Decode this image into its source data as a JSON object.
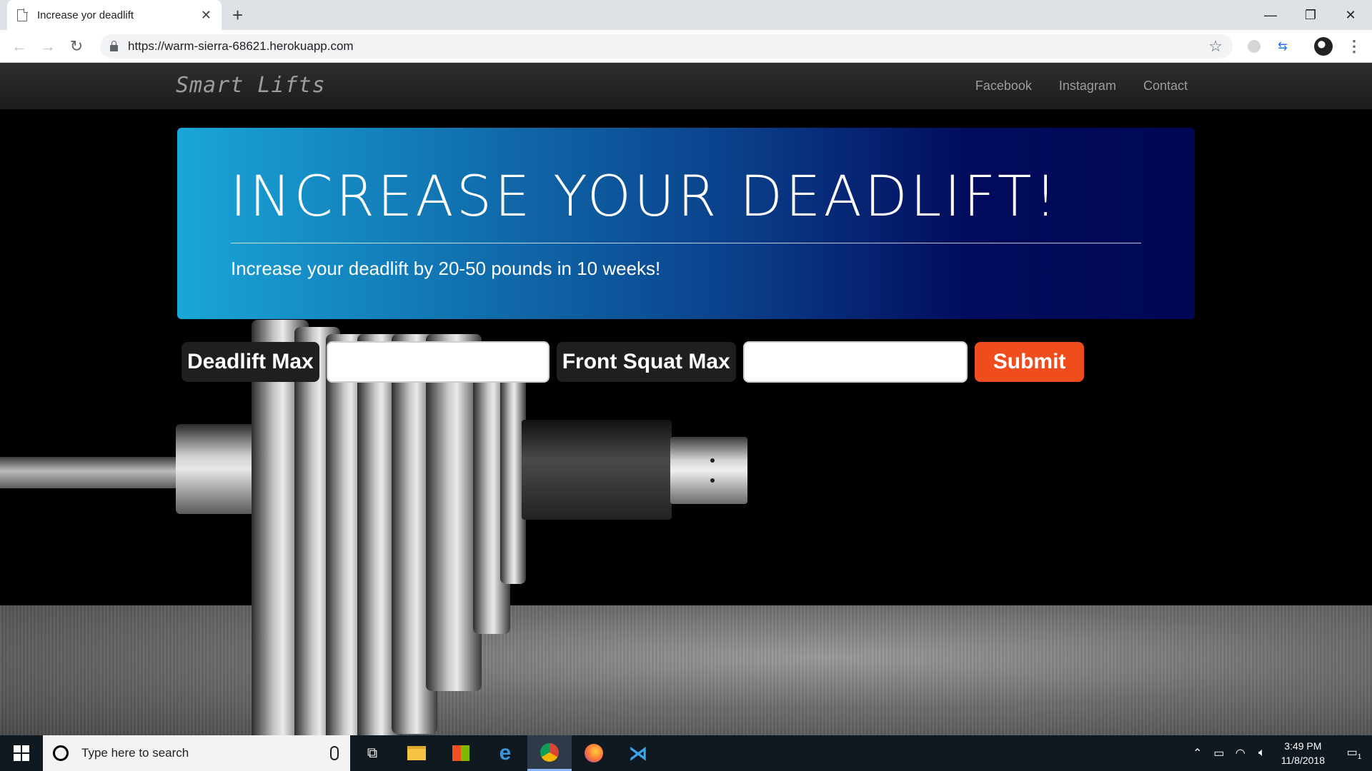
{
  "browser": {
    "tab_title": "Increase yor deadlift",
    "url": "https://warm-sierra-68621.herokuapp.com"
  },
  "navbar": {
    "brand": "Smart Lifts",
    "links": [
      {
        "label": "Facebook"
      },
      {
        "label": "Instagram"
      },
      {
        "label": "Contact"
      }
    ]
  },
  "jumbotron": {
    "headline": "INCREASE YOUR DEADLIFT!",
    "subtitle": "Increase your deadlift by 20-50 pounds in 10 weeks!",
    "gradient_start": "#1aa6d8",
    "gradient_end": "#000855"
  },
  "form": {
    "deadlift_label": "Deadlift Max",
    "deadlift_value": "",
    "front_squat_label": "Front Squat Max",
    "front_squat_value": "",
    "submit_label": "Submit",
    "submit_color": "#f04d1e"
  },
  "taskbar": {
    "search_placeholder": "Type here to search",
    "time": "3:49 PM",
    "date": "11/8/2018",
    "notification_count": "1"
  }
}
